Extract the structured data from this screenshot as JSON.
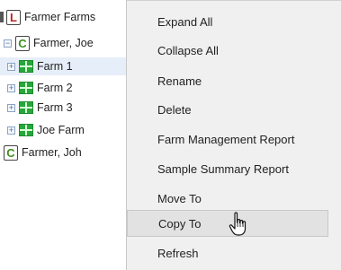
{
  "tree": {
    "root": {
      "label": "Farmer Farms",
      "icon": "L"
    },
    "grower_joe": {
      "label": "Farmer, Joe",
      "icon": "C"
    },
    "farms": [
      {
        "label": "Farm 1",
        "selected": true
      },
      {
        "label": "Farm 2"
      },
      {
        "label": "Farm 3"
      },
      {
        "label": "Joe Farm"
      }
    ],
    "grower_john": {
      "label": "Farmer, Joh",
      "icon": "C"
    },
    "expander_collapse": "⊟",
    "expander_expand": "+"
  },
  "context_menu": {
    "items": [
      {
        "label": "Expand All"
      },
      {
        "label": "Collapse All"
      },
      {
        "label": "Rename"
      },
      {
        "label": "Delete"
      },
      {
        "label": "Farm Management Report"
      },
      {
        "label": "Sample Summary Report"
      },
      {
        "label": "Move To"
      },
      {
        "label": "Copy To",
        "hovered": true
      },
      {
        "label": "Refresh"
      }
    ]
  },
  "colors": {
    "selection": "#e6eef9",
    "menu_bg": "#f0f0f0",
    "farm_green": "#27a73a",
    "letter_red": "#b8251d",
    "letter_green": "#3c8f1e"
  },
  "icons": {
    "cursor": "hand-pointer-icon"
  }
}
